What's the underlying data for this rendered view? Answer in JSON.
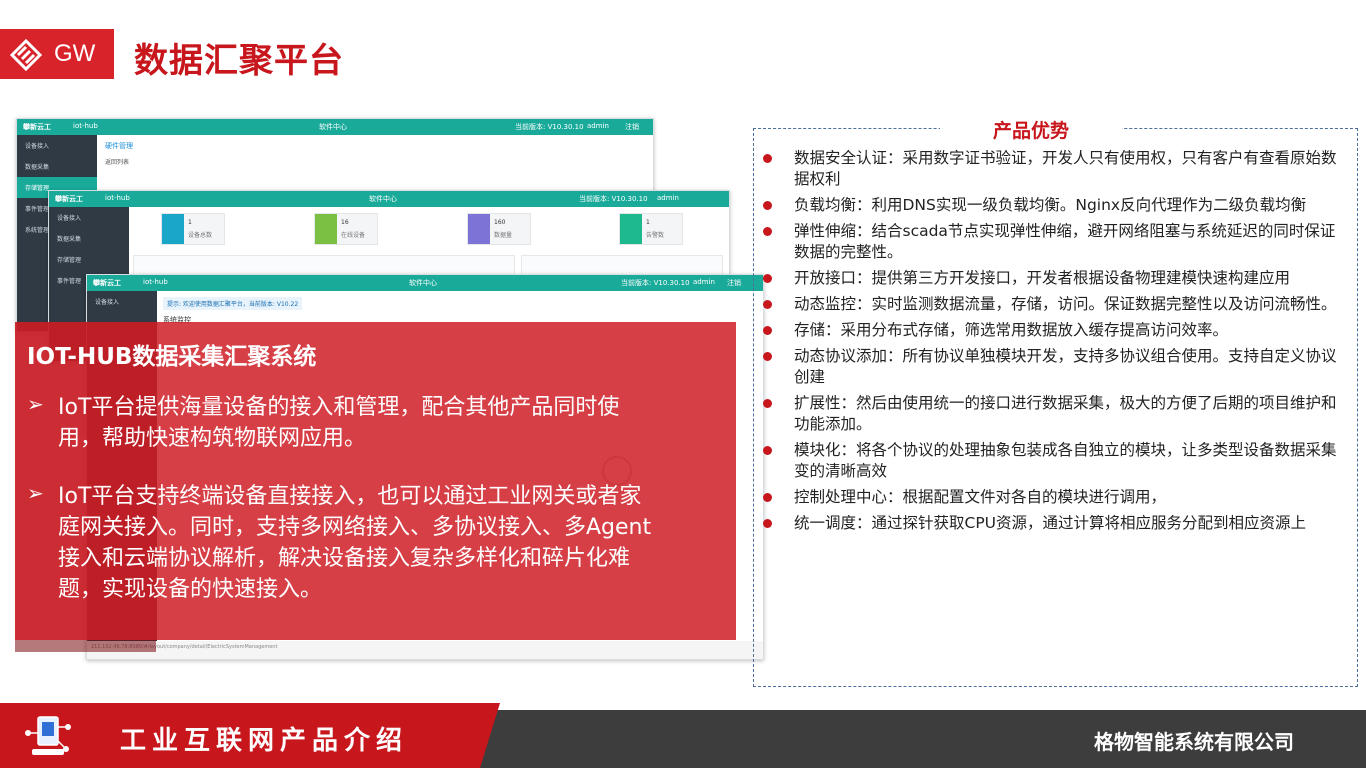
{
  "header": {
    "logo_text": "GW",
    "title": "数据汇聚平台"
  },
  "screenshot": {
    "brand": "攀新云工",
    "app_name": "iot-hub",
    "center_title": "软件中心",
    "version": "当前版本: V10.30.10",
    "user": "admin",
    "logout": "注销",
    "sidebar_items": [
      "设备接入",
      "数据采集",
      "存储管理",
      "事件管理",
      "系统管理"
    ],
    "page_title": "硬件管理",
    "back_link": "返回列表",
    "notice": "提示: 欢迎使用数据汇聚平台，当前版本: V10.22",
    "section_title": "系统监控",
    "status_url": "211.152.46.78:8080/#/layout/company/detail/ElectricSystemManagement",
    "cards": [
      {
        "num": "1",
        "label": "设备总数",
        "color": "#1aa6c9"
      },
      {
        "num": "16",
        "label": "在线设备",
        "color": "#7bc043"
      },
      {
        "num": "160",
        "label": "数据量",
        "color": "#7d73d6"
      },
      {
        "num": "1",
        "label": "告警数",
        "color": "#1fb98e"
      }
    ]
  },
  "overlay": {
    "title": "IOT-HUB数据采集汇聚系统",
    "bullets": [
      "IoT平台提供海量设备的接入和管理，配合其他产品同时使用，帮助快速构筑物联网应用。",
      "IoT平台支持终端设备直接接入，也可以通过工业网关或者家庭网关接入。同时，支持多网络接入、多协议接入、多Agent接入和云端协议解析，解决设备接入复杂多样化和碎片化难题，实现设备的快速接入。"
    ]
  },
  "advantages": {
    "title": "产品优势",
    "items": [
      "数据安全认证：采用数字证书验证，开发人只有使用权，只有客户有查看原始数据权利",
      "负载均衡：利用DNS实现一级负载均衡。Nginx反向代理作为二级负载均衡",
      "弹性伸缩：结合scada节点实现弹性伸缩，避开网络阻塞与系统延迟的同时保证数据的完整性。",
      "开放接口：提供第三方开发接口，开发者根据设备物理建模快速构建应用",
      "动态监控：实时监测数据流量，存储，访问。保证数据完整性以及访问流畅性。",
      "存储：采用分布式存储，筛选常用数据放入缓存提高访问效率。",
      "动态协议添加：所有协议单独模块开发，支持多协议组合使用。支持自定义协议创建",
      "扩展性：然后由使用统一的接口进行数据采集，极大的方便了后期的项目维护和功能添加。",
      "模块化：将各个协议的处理抽象包装成各自独立的模块，让多类型设备数据采集变的清晰高效",
      "控制处理中心：根据配置文件对各自的模块进行调用，",
      "统一调度：通过探针获取CPU资源，通过计算将相应服务分配到相应资源上"
    ]
  },
  "footer": {
    "title": "工业互联网产品介绍",
    "company": "格物智能系统有限公司"
  },
  "colors": {
    "brand_red": "#c8161d",
    "teal": "#19aa9a",
    "footer_dark": "#3d3d3d"
  }
}
